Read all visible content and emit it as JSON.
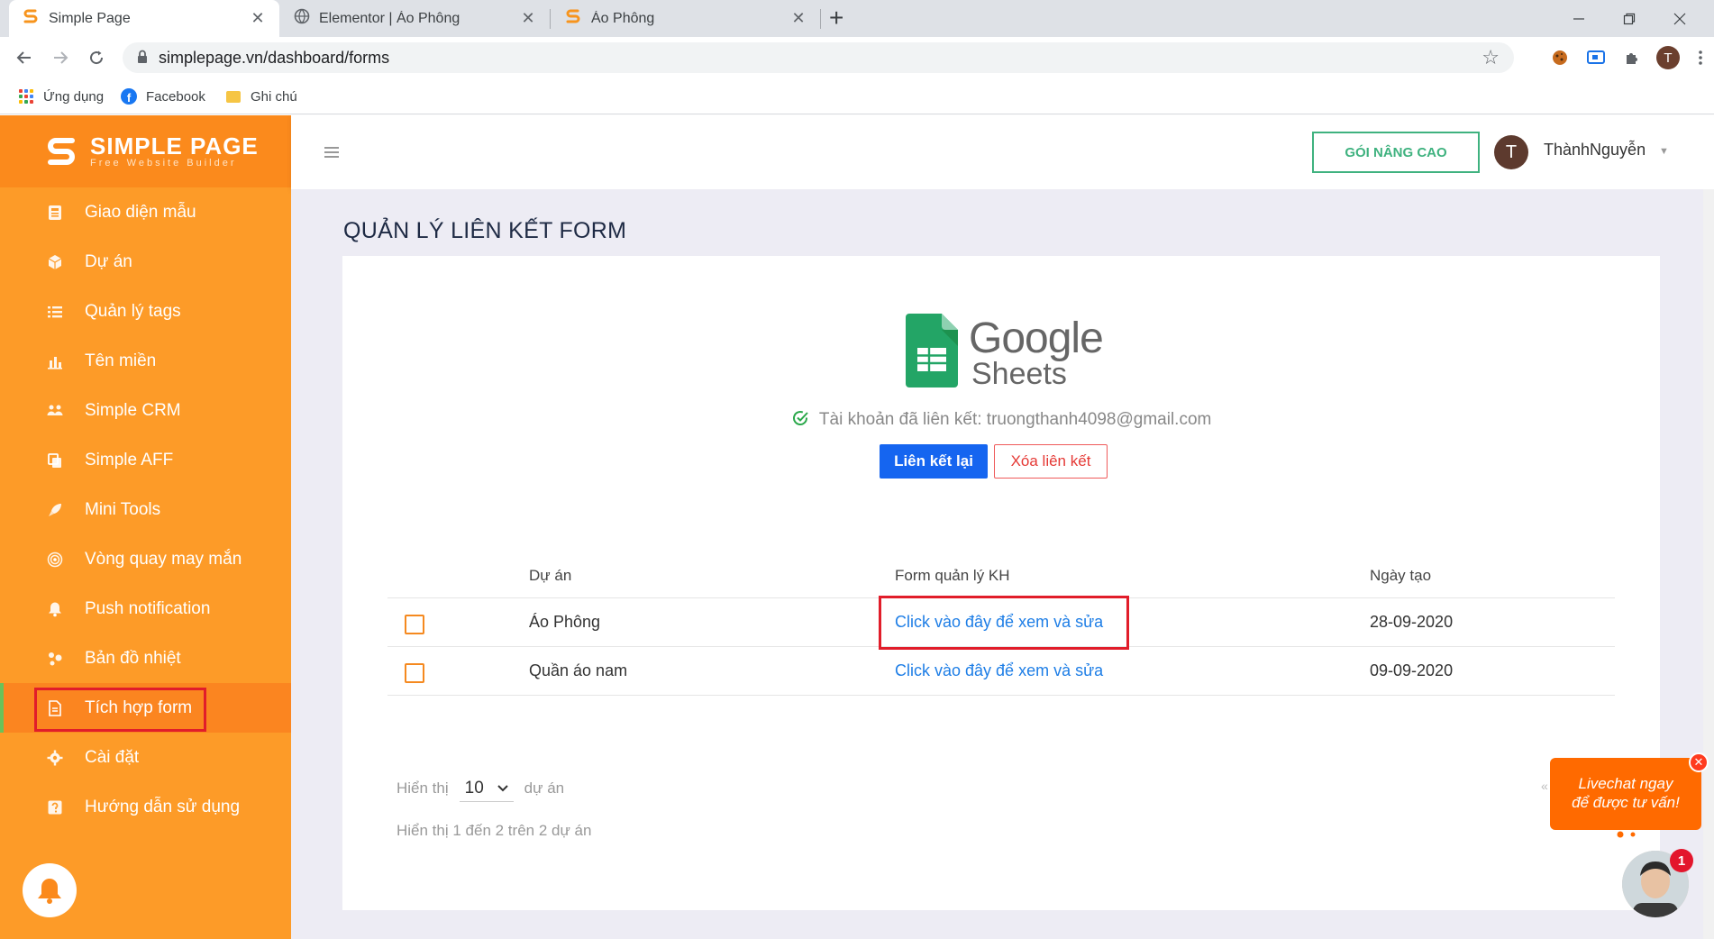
{
  "browser": {
    "tabs": [
      {
        "title": "Simple Page",
        "active": true
      },
      {
        "title": "Elementor | Áo Phông",
        "active": false
      },
      {
        "title": "Áo Phông",
        "active": false
      }
    ],
    "close_glyph": "✕",
    "new_tab_glyph": "+",
    "url": "simplepage.vn/dashboard/forms",
    "profile_initial": "T",
    "bookmarks": [
      {
        "label": "Ứng dụng",
        "icon": "apps-grid-icon"
      },
      {
        "label": "Facebook",
        "icon": "facebook-icon"
      },
      {
        "label": "Ghi chú",
        "icon": "folder-icon"
      }
    ]
  },
  "brand": {
    "name": "SIMPLE PAGE",
    "tagline": "Free Website Builder"
  },
  "sidebar": {
    "items": [
      {
        "label": "Giao diện mẫu",
        "icon": "template-icon"
      },
      {
        "label": "Dự án",
        "icon": "cube-icon"
      },
      {
        "label": "Quản lý tags",
        "icon": "list-icon"
      },
      {
        "label": "Tên miền",
        "icon": "bar-chart-icon"
      },
      {
        "label": "Simple CRM",
        "icon": "users-icon"
      },
      {
        "label": "Simple AFF",
        "icon": "copy-icon"
      },
      {
        "label": "Mini Tools",
        "icon": "rocket-icon"
      },
      {
        "label": "Vòng quay may mắn",
        "icon": "target-icon"
      },
      {
        "label": "Push notification",
        "icon": "bell-icon"
      },
      {
        "label": "Bản đồ nhiệt",
        "icon": "heatmap-icon"
      },
      {
        "label": "Tích hợp form",
        "icon": "form-icon",
        "active": true
      },
      {
        "label": "Cài đặt",
        "icon": "gear-icon"
      },
      {
        "label": "Hướng dẫn sử dụng",
        "icon": "help-icon"
      }
    ]
  },
  "topbar": {
    "upgrade_label": "GÓI NÂNG CAO",
    "user_initial": "T",
    "user_name": "ThànhNguyễn"
  },
  "page": {
    "title": "QUẢN LÝ LIÊN KẾT FORM",
    "logo_google": "Google",
    "logo_sheets": "Sheets",
    "linked_text": "Tài khoản đã liên kết: truongthanh4098@gmail.com",
    "relink_label": "Liên kết lại",
    "unlink_label": "Xóa liên kết"
  },
  "table": {
    "headers": [
      "Dự án",
      "Form quản lý KH",
      "Ngày tạo"
    ],
    "rows": [
      {
        "project": "Áo Phông",
        "form": "Click vào đây để xem và sửa",
        "date": "28-09-2020"
      },
      {
        "project": "Quần áo nam",
        "form": "Click vào đây để xem và sửa",
        "date": "09-09-2020"
      }
    ]
  },
  "pagination": {
    "show_label": "Hiển thị",
    "page_size": "10",
    "unit_label": "dự án",
    "info": "Hiển thị 1 đến 2 trên 2 dự án",
    "prev_glyph": "«"
  },
  "chat": {
    "line1": "Livechat ngay",
    "line2": "để được tư vấn!",
    "badge": "1",
    "close_glyph": "✕"
  },
  "colors": {
    "sidebar": "#fd9b28",
    "accent_green": "#3fb27f",
    "primary_blue": "#1565f0",
    "danger_red": "#e53935",
    "link_blue": "#1e7ee6",
    "highlight_red": "#e11d2a"
  }
}
